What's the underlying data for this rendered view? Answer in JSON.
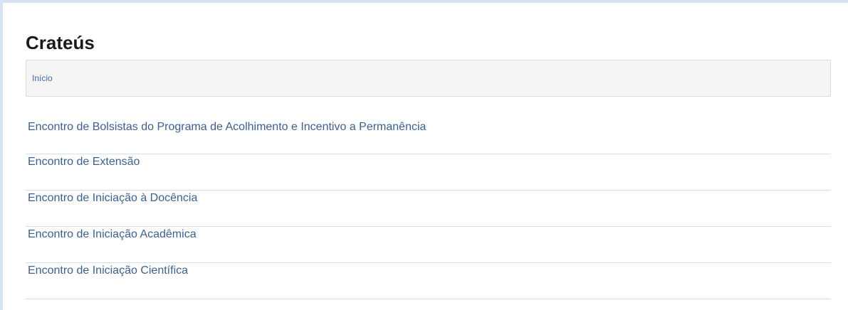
{
  "page": {
    "title": "Crateús"
  },
  "breadcrumb": {
    "items": [
      {
        "label": "Início"
      }
    ]
  },
  "events": [
    {
      "label": "Encontro de Bolsistas do Programa de Acolhimento e Incentivo a Permanência"
    },
    {
      "label": "Encontro de Extensão"
    },
    {
      "label": "Encontro de Iniciação à Docência"
    },
    {
      "label": "Encontro de Iniciação Acadêmica"
    },
    {
      "label": "Encontro de Iniciação Científica"
    }
  ],
  "colors": {
    "link": "#3d5f8f",
    "divider": "#cfe0ee",
    "frame_border": "#d7e3f0",
    "breadcrumb_bg": "#f5f5f5"
  }
}
